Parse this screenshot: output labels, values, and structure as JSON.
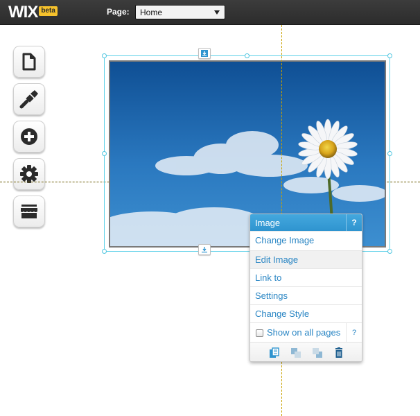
{
  "app": {
    "logo_text": "WIX",
    "beta_label": "beta"
  },
  "toolbar": {
    "page_label": "Page:",
    "page_select_value": "Home"
  },
  "left_tools": [
    {
      "icon": "page-icon"
    },
    {
      "icon": "brush-icon"
    },
    {
      "icon": "add-icon"
    },
    {
      "icon": "gear-icon"
    },
    {
      "icon": "store-icon"
    }
  ],
  "context_menu": {
    "title": "Image",
    "help_label": "?",
    "items": [
      {
        "label": "Change Image"
      },
      {
        "label": "Edit Image"
      },
      {
        "label": "Link to"
      },
      {
        "label": "Settings"
      },
      {
        "label": "Change Style"
      }
    ],
    "show_on_all_pages": {
      "label": "Show on all pages",
      "checked": false,
      "help_label": "?"
    },
    "footer_tools": [
      "duplicate-icon",
      "bring-forward-icon",
      "send-backward-icon",
      "trash-icon"
    ]
  },
  "colors": {
    "accent": "#2f94cf",
    "link": "#2a86c4",
    "selection": "#5ad0e8",
    "beta_badge": "#f6c22c",
    "topbar": "#333333",
    "guide": "#c9a200"
  }
}
